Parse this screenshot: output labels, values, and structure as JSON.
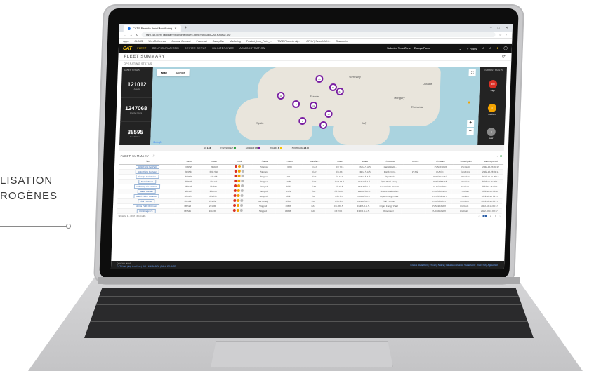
{
  "side_text": {
    "line1": "LISATION",
    "line2": "ROGÈNES"
  },
  "browser": {
    "tab_title": "CAT® Remote Asset Monitoring",
    "new_tab": "+",
    "window_controls": [
      "–",
      "□",
      "✕"
    ],
    "url": "ram.cat.com/Tangramr/Runtime/index.html?rundup=CAT.RAMUI.NU",
    "bookmarks": [
      "Apps",
      "CLASS",
      "WordReference",
      "General Connect",
      "Powernet",
      "Caterpillar",
      "Marketing",
      "Product_Link_Parts_...",
      "TAPE Phonetic Alp...",
      "OPHY | Search All t...",
      "Sharepoint"
    ]
  },
  "app_nav": {
    "logo_main": "CAT",
    "items": [
      "FLEET",
      "CONFIGURATIONS",
      "DEVICE SETUP",
      "MAINTENANCE",
      "ADMINISTRATION"
    ],
    "timezone_label": "Selected Time Zone:",
    "timezone_value": "Europe/Paris",
    "filters_label": "Filters",
    "icons": [
      "filter-icon",
      "building-icon",
      "home-icon",
      "bell-icon",
      "user-icon"
    ]
  },
  "page": {
    "title": "FLEET SUMMARY",
    "operating_status_label": "OPERATING STATUS"
  },
  "asset_totals": {
    "header": "ASSET TOTALS",
    "stats": [
      {
        "value": "121012",
        "label": "Assets"
      },
      {
        "value": "1247068",
        "label": "Engine Hours"
      },
      {
        "value": "38595",
        "label": "Fuel Burned"
      }
    ]
  },
  "map": {
    "tabs": [
      "Map",
      "Satellite"
    ],
    "labels": [
      "Germany",
      "Ukraine",
      "France",
      "Italy",
      "Romania",
      "Spain",
      "Hungary"
    ],
    "clusters": [
      "73",
      "15",
      "64",
      "11",
      "9",
      "41",
      "12",
      "8",
      "5"
    ],
    "google": "Google"
  },
  "current_faults": {
    "header": "CURRENT FAULTS",
    "items": [
      {
        "value": "208",
        "label": "High",
        "color": "#d93025"
      },
      {
        "value": "4",
        "label": "Medium",
        "color": "#f4a300"
      },
      {
        "value": "0",
        "label": "Low",
        "color": "#8a8a8a"
      }
    ]
  },
  "status_legend": [
    {
      "label": "All",
      "count": "134"
    },
    {
      "label": "Running",
      "count": "12"
    },
    {
      "label": "Stopped",
      "count": "89"
    },
    {
      "label": "Ready",
      "count": "8"
    },
    {
      "label": "Not Ready",
      "count": "24"
    }
  ],
  "fleet_table": {
    "title": "FLEET SUMMARY",
    "columns": [
      "Site",
      "Asset",
      "Asset",
      "Fault",
      "Status",
      "Hours",
      "Manufac...",
      "Model",
      "Dealer",
      "Customer",
      "Device",
      "Firmware",
      "Subscription",
      "Last Reported"
    ],
    "rows": [
      [
        "D3D Thing Go Pam",
        "389523",
        "221048",
        "hi",
        "Stopped",
        "3204",
        "CAT",
        "C3 T3.5",
        "EMEA S.A.S.",
        "Daniel Dam...",
        "",
        "PU5CE50M3",
        "Premium",
        "2022-10-26 01:17"
      ],
      [
        "D3D Thing Gol Mec",
        "389521",
        "389 7018",
        "hi",
        "Stopped",
        "",
        "CAT",
        "C4.4R4",
        "EMEA S.A.S.",
        "Bomb Pam...",
        "PL542",
        "PU5CE1",
        "CoreFeed",
        "2022-10-28 01:11"
      ],
      [
        "Groupe Gol Poche",
        "389521",
        "221188",
        "hi",
        "Stopped",
        "1514",
        "CAT",
        "C3 T3.5",
        "EMEA S.A.S.",
        "Opt Mech",
        "",
        "PU5CE1N4AC",
        "Premium",
        "2022-10-15 09:17"
      ],
      [
        "Nacel Moser",
        "389522",
        "221779",
        "hi",
        "Stopped",
        "4165",
        "CAT",
        "C4.4 T4.2",
        "EMEA S.A.S.",
        "Opts Metal Energ..",
        "",
        "PU5CE0M4A6",
        "Premium",
        "2022-10-15 09:17"
      ],
      [
        "Def Temp Vie Vernem",
        "389523",
        "221845",
        "hi",
        "Stopped",
        "8282",
        "CAT",
        "C3 T3.6",
        "EMEA S.A.S.",
        "San Dol Vie Vernem",
        "",
        "PU5C2D2DN",
        "Premium",
        "2022-10-15 09:17"
      ],
      [
        "Basel Fontain",
        "389522",
        "221555",
        "hi",
        "Stopped",
        "4521",
        "CAT",
        "C3 2R8.8",
        "EMEA S.A.S.",
        "Groupe Mathoutlan",
        "",
        "PU5C2R8N0H",
        "Premium",
        "2022-10-15 09:17"
      ],
      [
        "Basel Pleine Rotation",
        "389523",
        "221838",
        "hi",
        "Stopped",
        "12027",
        "CAT",
        "C3 T3.5",
        "EMEA S.A.S.",
        "Organ Energy Plant",
        "",
        "PU5C2D2N0H",
        "Premium",
        "2022-10-15 09:17"
      ],
      [
        "Gal Pomme",
        "389522",
        "221838",
        "hi",
        "Not Ready",
        "12846",
        "CAT",
        "C3 T3.5",
        "EMEA S.A.S.",
        "Sail Pomme",
        "",
        "PU5C2646H5",
        "Premium",
        "2022-10-15 09:17"
      ],
      [
        "Drems Petite Bellevue",
        "389523",
        "221838",
        "hi",
        "Stopped",
        "13646",
        "CAT",
        "C4.4R6.5",
        "EMEA S.A.S.",
        "Organ Energy Plant",
        "",
        "PU5C2D4N0H",
        "Premium",
        "2022-10-15 09:17"
      ],
      [
        "Pontenagen S",
        "389521",
        "221838",
        "hi",
        "Stopped",
        "13846",
        "CAT",
        "C3 T3.5",
        "EMEA S.A.S.",
        "Rosenauer",
        "",
        "PU5C2D2N0H",
        "Premium",
        "2022-10-15 09:17"
      ]
    ],
    "showing": "Showing 1 - 10 of 134 results",
    "pages": [
      "‹",
      "1",
      "2",
      "3",
      "›"
    ]
  },
  "footer": {
    "quick_links_label": "QUICK LINKS",
    "quick_links": "CAT.COM | My Cat.Com | SIS | SIS PARTS | DEALER SITE",
    "legal": "Cookie Statement | Privacy Notice | Data Governance Statement | Third Party Agreement"
  }
}
